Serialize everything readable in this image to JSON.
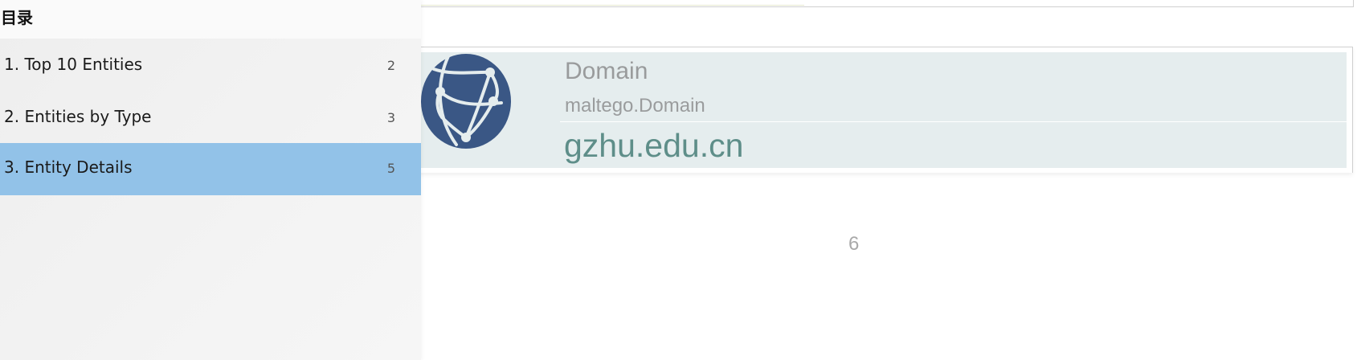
{
  "toc": {
    "title": "目录",
    "items": [
      {
        "label": "1. Top 10 Entities",
        "page": "2",
        "selected": false
      },
      {
        "label": "2. Entities by Type",
        "page": "3",
        "selected": false
      },
      {
        "label": "3. Entity Details",
        "page": "5",
        "selected": true
      }
    ]
  },
  "entity_card": {
    "icon": "globe-network-icon",
    "type_label": "Domain",
    "type_class": "maltego.Domain",
    "value": "gzhu.edu.cn"
  },
  "page": {
    "number": "6"
  },
  "colors": {
    "selected_item": "#92c2e8",
    "card_background": "#e5edee",
    "entity_value": "#5e8e89",
    "globe": "#3a5785"
  }
}
